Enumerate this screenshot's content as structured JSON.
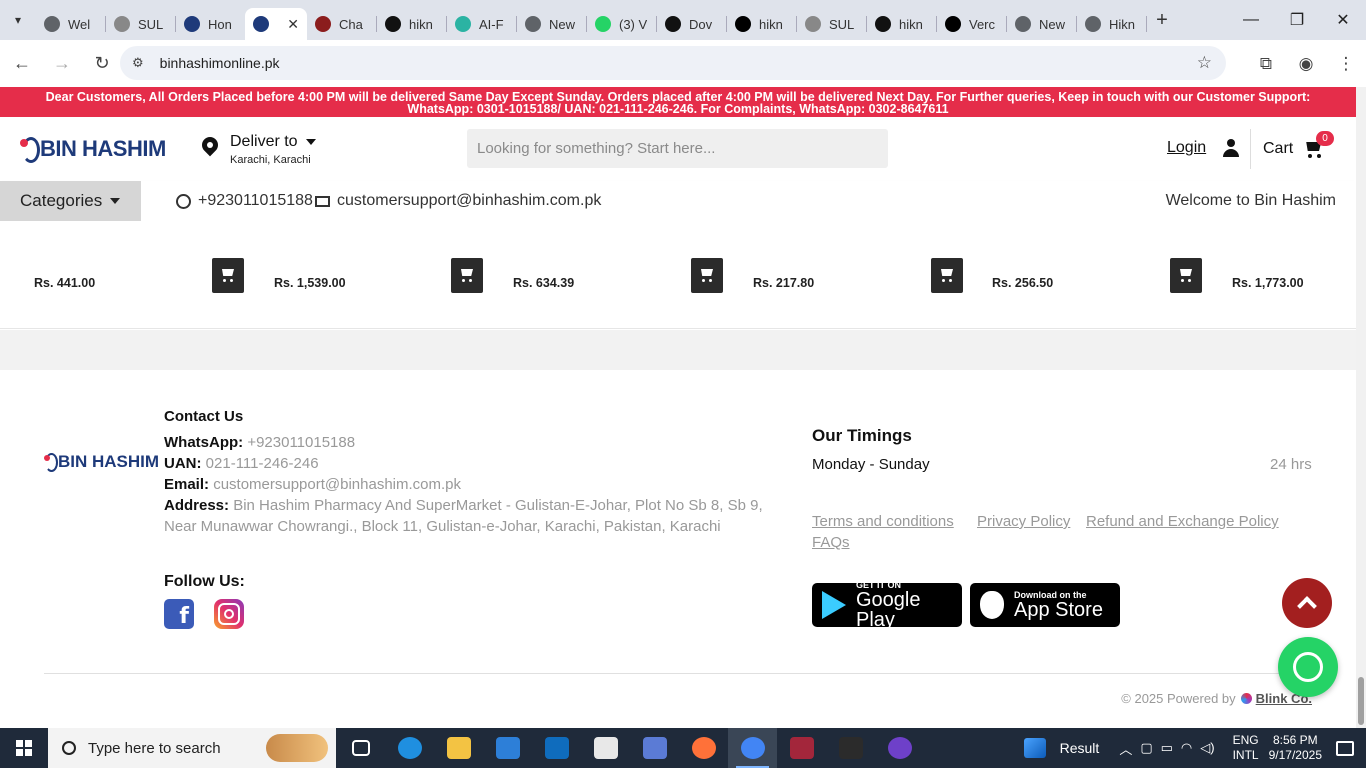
{
  "browser": {
    "tabs": [
      {
        "title": "Wel",
        "icon": "chrome-icon",
        "color": "#5f6368"
      },
      {
        "title": "SUL",
        "icon": "page-icon",
        "color": "#888888"
      },
      {
        "title": "Hon",
        "icon": "brand-icon",
        "color": "#1e3a7a"
      },
      {
        "title": "",
        "icon": "binhashim-icon",
        "color": "#1e3a7a",
        "active": true
      },
      {
        "title": "Cha",
        "icon": "ai-icon",
        "color": "#8b1d1d"
      },
      {
        "title": "hikn",
        "icon": "github-icon",
        "color": "#111111"
      },
      {
        "title": "AI-F",
        "icon": "star-icon",
        "color": "#2bb3a3"
      },
      {
        "title": "New",
        "icon": "chrome-icon",
        "color": "#5f6368"
      },
      {
        "title": "(3) V",
        "icon": "whatsapp-icon",
        "color": "#25d366"
      },
      {
        "title": "Dov",
        "icon": "github-icon",
        "color": "#111111"
      },
      {
        "title": "hikn",
        "icon": "vercel-icon",
        "color": "#000000"
      },
      {
        "title": "SUL",
        "icon": "page-icon",
        "color": "#888888"
      },
      {
        "title": "hikn",
        "icon": "github-icon",
        "color": "#111111"
      },
      {
        "title": "Verc",
        "icon": "vercel-icon",
        "color": "#000000"
      },
      {
        "title": "New",
        "icon": "chrome-icon",
        "color": "#5f6368"
      },
      {
        "title": "Hikn",
        "icon": "chrome-icon",
        "color": "#5f6368"
      }
    ],
    "url": "binhashimonline.pk"
  },
  "banner": {
    "line1": "Dear Customers, All Orders Placed before 4:00 PM will be delivered Same Day Except Sunday. Orders placed after 4:00 PM will be delivered Next Day. For Further queries, Keep in touch with our Customer Support:",
    "line2": "WhatsApp: 0301-1015188/ UAN: 021-111-246-246. For Complaints, WhatsApp: 0302-8647611"
  },
  "header": {
    "logo_text": "BIN HASHIM",
    "deliver_label": "Deliver to",
    "deliver_location": "Karachi, Karachi",
    "search_placeholder": "Looking for something? Start here...",
    "login_label": "Login",
    "cart_label": "Cart",
    "cart_count": "0"
  },
  "subnav": {
    "categories_label": "Categories",
    "phone": "+923011015188",
    "email": "customersupport@binhashim.com.pk",
    "welcome": "Welcome to Bin Hashim"
  },
  "products": [
    {
      "price": "Rs. 441.00"
    },
    {
      "price": "Rs. 1,539.00"
    },
    {
      "price": "Rs. 634.39"
    },
    {
      "price": "Rs. 217.80"
    },
    {
      "price": "Rs. 256.50"
    },
    {
      "price": "Rs. 1,773.00"
    }
  ],
  "footer": {
    "logo_text": "BIN HASHIM",
    "contact_heading": "Contact Us",
    "whatsapp_label": "WhatsApp:",
    "whatsapp_value": "+923011015188",
    "uan_label": "UAN:",
    "uan_value": "021-111-246-246",
    "email_label": "Email:",
    "email_value": "customersupport@binhashim.com.pk",
    "address_label": "Address:",
    "address_line1": "Bin Hashim Pharmacy And SuperMarket - Gulistan-E-Johar, Plot No Sb 8, Sb 9,",
    "address_line2": "Near Munawwar Chowrangi., Block 11, Gulistan-e-Johar, Karachi, Pakistan, Karachi",
    "follow_heading": "Follow Us:",
    "timings_heading": "Our Timings",
    "timing_days": "Monday - Sunday",
    "timing_hours": "24 hrs",
    "links": {
      "terms": "Terms and conditions",
      "privacy": "Privacy Policy",
      "refund": "Refund and Exchange Policy",
      "faqs": "FAQs"
    },
    "google_play_small": "GET IT ON",
    "google_play_large": "Google Play",
    "app_store_small": "Download on the",
    "app_store_large": "App Store",
    "powered_prefix": "© 2025 Powered by",
    "powered_brand": "Blink Co."
  },
  "taskbar": {
    "search_placeholder": "Type here to search",
    "weather_label": "Result",
    "lang_line1": "ENG",
    "lang_line2": "INTL",
    "time": "8:56 PM",
    "date": "9/17/2025",
    "apps": [
      {
        "name": "task-view",
        "color": "#ffffff"
      },
      {
        "name": "edge",
        "color": "#1f8fe0"
      },
      {
        "name": "file-explorer",
        "color": "#f3c343"
      },
      {
        "name": "microsoft-store",
        "color": "#2d7fd8"
      },
      {
        "name": "outlook",
        "color": "#0f6cbd"
      },
      {
        "name": "notepad",
        "color": "#e8e8e8"
      },
      {
        "name": "network-app",
        "color": "#5b7bd5"
      },
      {
        "name": "firefox",
        "color": "#ff7139"
      },
      {
        "name": "chrome",
        "color": "#4285f4",
        "active": true
      },
      {
        "name": "winrar",
        "color": "#a3263b"
      },
      {
        "name": "terminal",
        "color": "#2b2b2b"
      },
      {
        "name": "github-desktop",
        "color": "#6e40c9"
      }
    ]
  },
  "colors": {
    "banner": "#e52d4a",
    "brand": "#1e3a7a",
    "scroll_top": "#a31f1f",
    "whatsapp": "#25d366"
  }
}
